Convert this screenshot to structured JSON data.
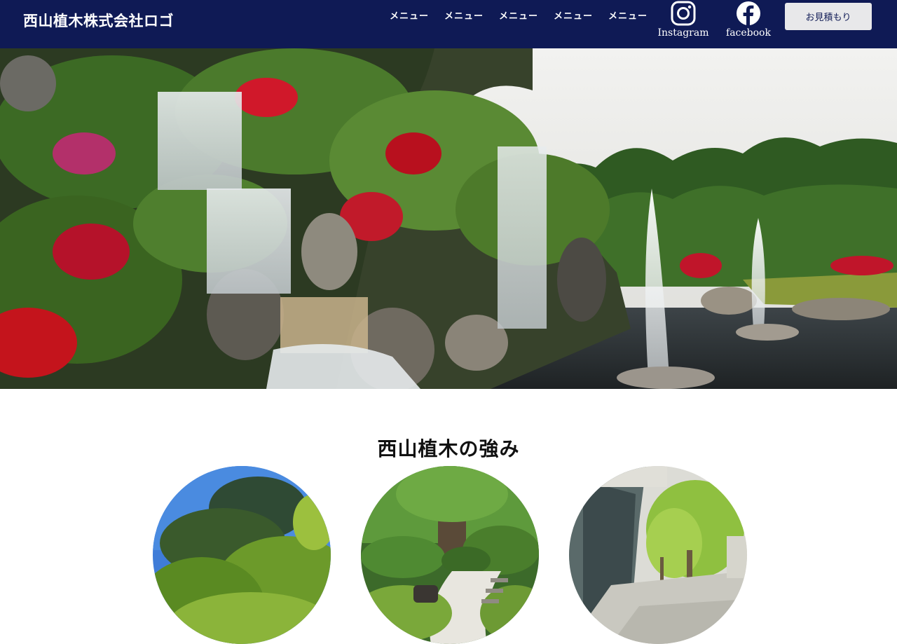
{
  "header": {
    "logo_text": "西山植木株式会社ロゴ",
    "nav_items": [
      "メニュー",
      "メニュー",
      "メニュー",
      "メニュー",
      "メニュー"
    ],
    "social": {
      "instagram_label": "Instagram",
      "facebook_label": "facebook"
    },
    "quote_button_label": "お見積もり"
  },
  "hero": {
    "image": "japanese-garden-waterfall-fountains"
  },
  "strengths": {
    "title": "西山植木の強み",
    "images": [
      "pine-tree-blue-sky",
      "japanese-garden-path",
      "building-courtyard-trees"
    ]
  },
  "colors": {
    "header_bg": "#0f1a55",
    "button_bg": "#e8e8ea"
  }
}
